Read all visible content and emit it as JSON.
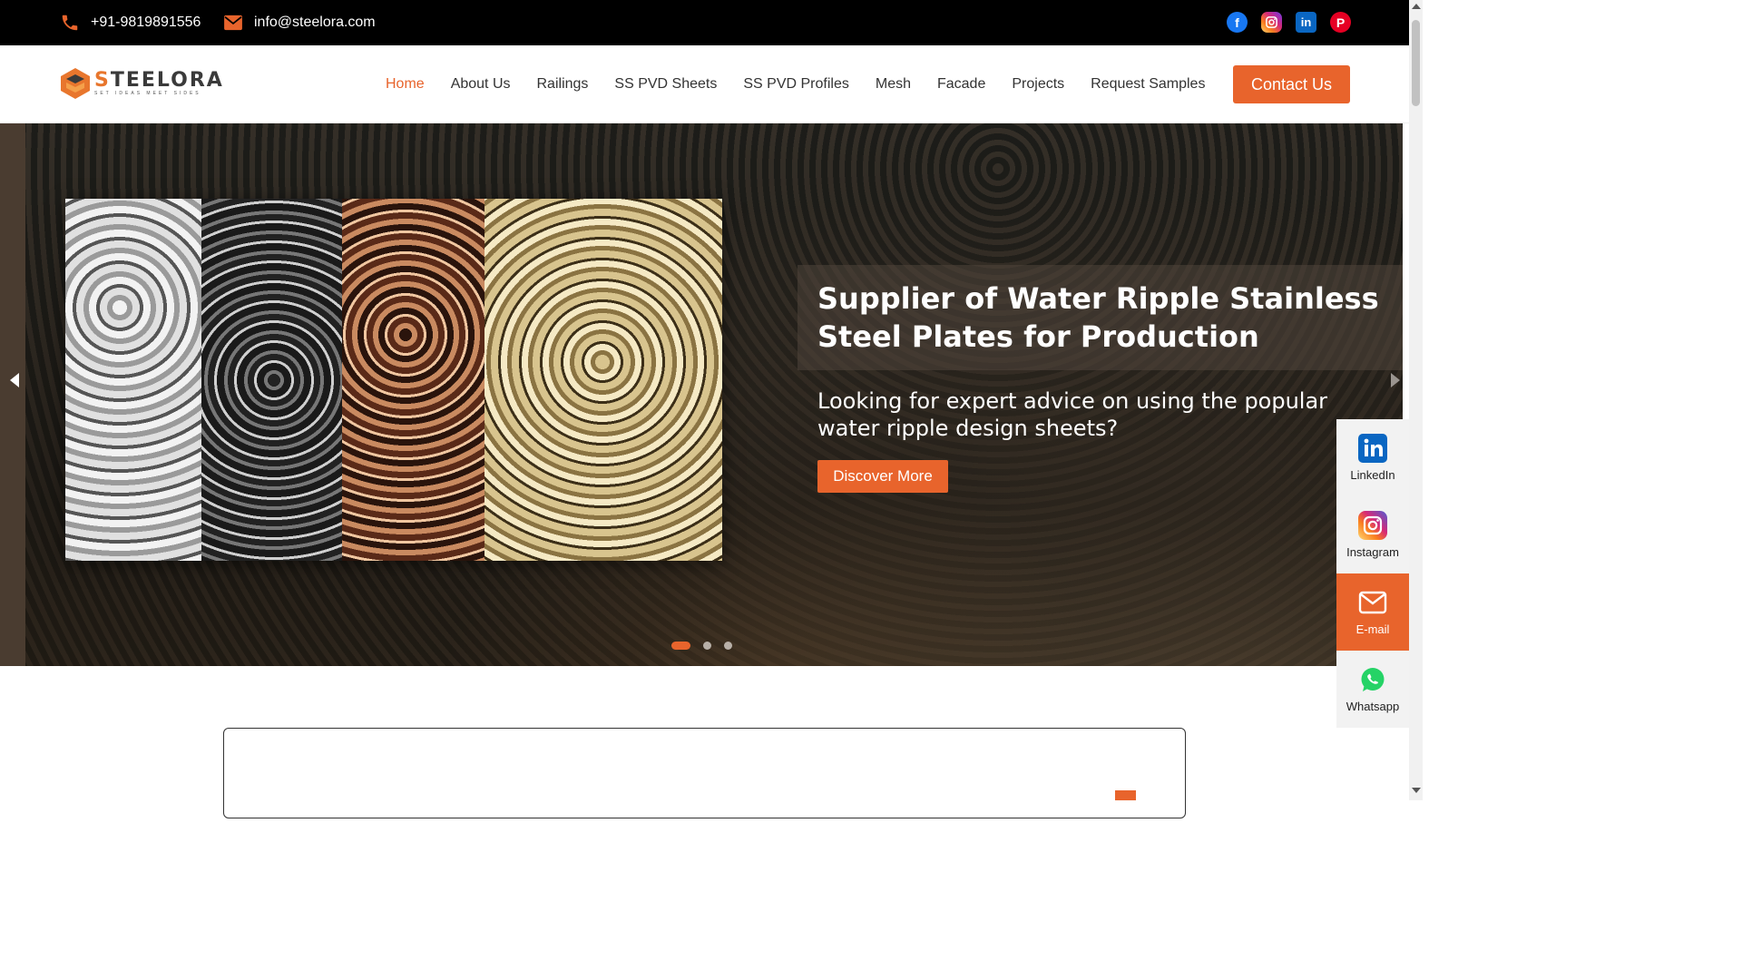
{
  "topbar": {
    "phone": "+91-9819891556",
    "email": "info@steelora.com",
    "socials": [
      {
        "name": "facebook",
        "glyph": "f"
      },
      {
        "name": "instagram",
        "glyph": ""
      },
      {
        "name": "linkedin",
        "glyph": "in"
      },
      {
        "name": "pinterest",
        "glyph": "P"
      }
    ]
  },
  "header": {
    "logo_word_a": "S",
    "logo_word_b": "TEELORA",
    "logo_tagline": "SET IDEAS MEET SIDES",
    "nav": [
      "Home",
      "About Us",
      "Railings",
      "SS PVD Sheets",
      "SS PVD Profiles",
      "Mesh",
      "Facade",
      "Projects",
      "Request Samples"
    ],
    "active_nav": "Home",
    "contact_button": "Contact Us"
  },
  "hero": {
    "title": "Supplier of Water Ripple Stainless Steel Plates for Production",
    "subtitle": "Looking for expert advice on using the popular water ripple design sheets?",
    "cta": "Discover More",
    "slides": 3,
    "active_slide": 1
  },
  "float_bar": {
    "items": [
      {
        "label": "LinkedIn",
        "icon": "linkedin-icon"
      },
      {
        "label": "Instagram",
        "icon": "instagram-icon"
      },
      {
        "label": "E-mail",
        "icon": "email-icon"
      },
      {
        "label": "Whatsapp",
        "icon": "whatsapp-icon"
      }
    ]
  },
  "colors": {
    "accent": "#e8642c",
    "topbar_bg": "#000000"
  }
}
